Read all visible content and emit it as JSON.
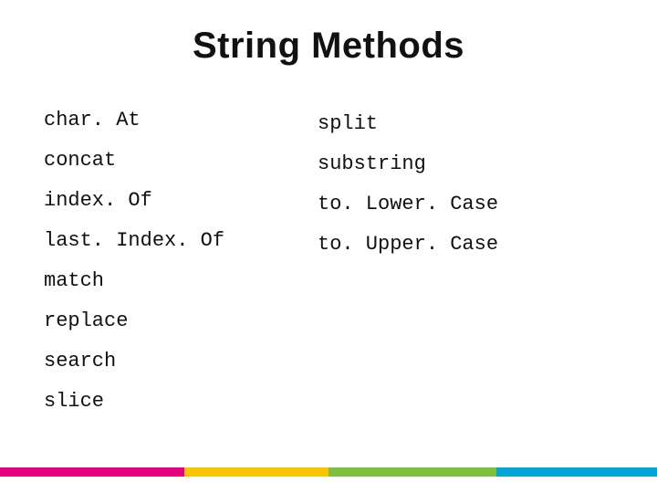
{
  "title": "String Methods",
  "columns": {
    "left": [
      "char. At",
      "concat",
      "index. Of",
      "last. Index. Of",
      "match",
      "replace",
      "search",
      "slice"
    ],
    "right": [
      "split",
      "substring",
      "to. Lower. Case",
      "to. Upper. Case"
    ]
  },
  "colors": {
    "stripe": [
      "#e7007f",
      "#f7c600",
      "#7fbf3f",
      "#00a4d6"
    ]
  }
}
